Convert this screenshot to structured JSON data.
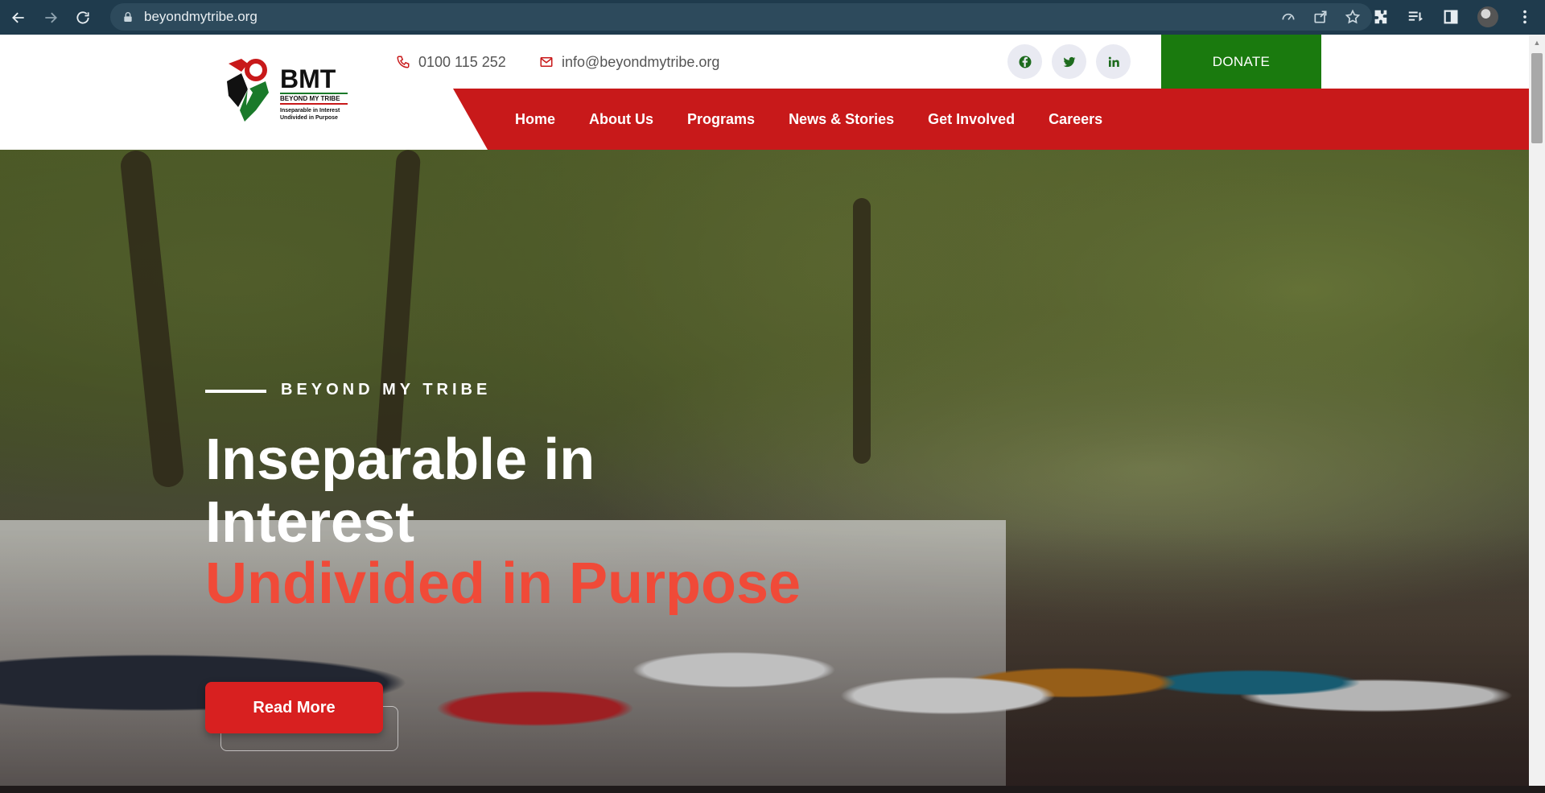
{
  "browser": {
    "url": "beyondmytribe.org"
  },
  "site": {
    "logo": {
      "name": "BMT",
      "subtitle": "BEYOND MY TRIBE",
      "tagline_1": "Inseparable in Interest",
      "tagline_2": "Undivided in Purpose"
    },
    "phone": "0100 115 252",
    "email": "info@beyondmytribe.org",
    "socials": [
      "facebook",
      "twitter",
      "linkedin"
    ],
    "donate_label": "DONATE",
    "menu": [
      "Home",
      "About Us",
      "Programs",
      "News & Stories",
      "Get Involved",
      "Careers"
    ],
    "colors": {
      "brand_red": "#c8191a",
      "brand_green": "#1a7a0e",
      "accent_red": "#f04a38"
    }
  },
  "hero": {
    "eyebrow": "BEYOND MY TRIBE",
    "title_line1": "Inseparable in",
    "title_line2": "Interest",
    "title_highlight": "Undivided in Purpose",
    "cta_label": "Read More"
  }
}
